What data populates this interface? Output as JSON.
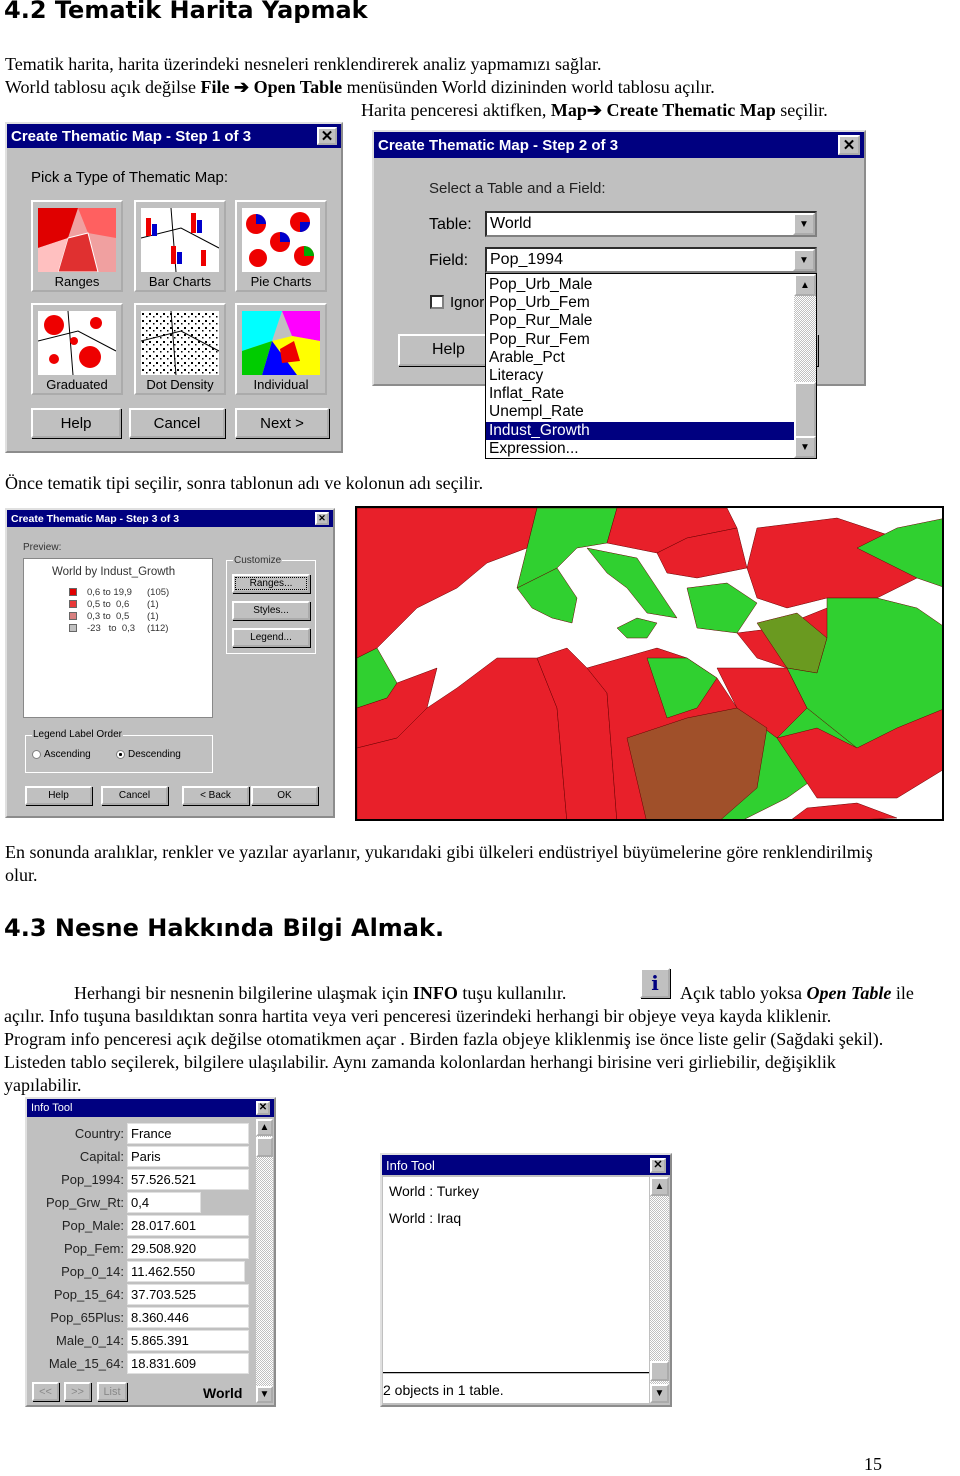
{
  "section1": {
    "title": "4.2  Tematik Harita Yapmak",
    "line1": "Tematik harita, harita üzerindeki nesneleri renklendirerek analiz yapmamızı sağlar.",
    "line2_a": "World tablosu açık değilse ",
    "line2_b": "File ➔ Open Table",
    "line2_c": " menüsünden World dizininden world tablosu açılır.",
    "line3_a": "Harita penceresi aktifken, ",
    "line3_b": "Map➔ Create Thematic Map",
    "line3_c": " seçilir."
  },
  "step1": {
    "title": "Create Thematic Map - Step 1 of 3",
    "prompt": "Pick a Type of Thematic Map:",
    "types": [
      "Ranges",
      "Bar Charts",
      "Pie Charts",
      "Graduated",
      "Dot Density",
      "Individual"
    ],
    "buttons": [
      "Help",
      "Cancel",
      "Next >"
    ]
  },
  "step2": {
    "title": "Create Thematic Map - Step 2 of 3",
    "prompt": "Select a Table and a Field:",
    "table_label": "Table:",
    "table_value": "World",
    "field_label": "Field:",
    "field_value": "Pop_1994",
    "ignore_label": "Ignor",
    "help": "Help",
    "options": [
      "Pop_Urb_Male",
      "Pop_Urb_Fem",
      "Pop_Rur_Male",
      "Pop_Rur_Fem",
      "Arable_Pct",
      "Literacy",
      "Inflat_Rate",
      "Unempl_Rate",
      "Indust_Growth",
      "Expression..."
    ],
    "selected": "Indust_Growth"
  },
  "caption1": "Önce tematik tipi seçilir, sonra tablonun adı ve kolonun adı seçilir.",
  "step3": {
    "title": "Create Thematic Map - Step 3 of 3",
    "preview_label": "Preview:",
    "legend_title": "World by Indust_Growth",
    "legend": [
      {
        "range": "0,6 to 19,9",
        "count": "(105)",
        "color": "#e00000"
      },
      {
        "range": "0,5 to  0,6",
        "count": "(1)",
        "color": "#e83838"
      },
      {
        "range": "0,3 to  0,5",
        "count": "(1)",
        "color": "#d88080"
      },
      {
        "range": "-23   to  0,3",
        "count": "(112)",
        "color": "#c0c0c0"
      }
    ],
    "customize": "Customize",
    "custom_buttons": [
      "Ranges...",
      "Styles...",
      "Legend..."
    ],
    "order_label": "Legend Label Order",
    "ascending": "Ascending",
    "descending": "Descending",
    "selected_order": "Descending",
    "buttons": [
      "Help",
      "Cancel",
      "< Back",
      "OK"
    ]
  },
  "map_colors": {
    "red": "#e8202a",
    "green": "#30d030",
    "olive": "#6a9a20",
    "brown": "#a0502a",
    "sea": "#ffffff"
  },
  "para2": {
    "line1": "En sonunda aralıklar, renkler ve yazılar ayarlanır, yukarıdaki gibi ülkeleri endüstriyel büyümelerine göre renklendirilmiş",
    "line2": "olur."
  },
  "section2": {
    "title": "4.3  Nesne Hakkında Bilgi Almak.",
    "l1a": "Herhangi bir nesnenin bilgilerine ulaşmak için ",
    "l1b": "INFO",
    "l1c": " tuşu kullanılır.",
    "l1d": "Açık tablo yoksa ",
    "l1e": "Open Table",
    "l1f": " ile",
    "l2": "açılır. Info tuşuna basıldıktan sonra hartita veya veri penceresi üzerindeki herhangi bir objeye veya kayda kliklenir.",
    "l3": "Program info penceresi açık değilse otomatikmen açar . Birden fazla objeye kliklenmiş ise önce liste gelir (Sağdaki şekil).",
    "l4": "Listeden tablo seçilerek, bilgilere ulaşılabilir. Aynı zamanda kolonlardan herhangi birisine veri girliebilir, değişiklik",
    "l5": "yapılabilir."
  },
  "info1": {
    "title": "Info Tool",
    "rows": [
      [
        "Country:",
        "France"
      ],
      [
        "Capital:",
        "Paris"
      ],
      [
        "Pop_1994:",
        "57.526.521"
      ],
      [
        "Pop_Grw_Rt:",
        "0,4"
      ],
      [
        "Pop_Male:",
        "28.017.601"
      ],
      [
        "Pop_Fem:",
        "29.508.920"
      ],
      [
        "Pop_0_14:",
        "11.462.550"
      ],
      [
        "Pop_15_64:",
        "37.703.525"
      ],
      [
        "Pop_65Plus:",
        "8.360.446"
      ],
      [
        "Male_0_14:",
        "5.865.391"
      ],
      [
        "Male_15_64:",
        "18.831.609"
      ]
    ],
    "nav": [
      "<<",
      ">>",
      "List"
    ],
    "table": "World"
  },
  "info2": {
    "title": "Info Tool",
    "items": [
      "World : Turkey",
      "World : Iraq"
    ],
    "status": "2 objects in 1 table."
  },
  "page_number": "15"
}
